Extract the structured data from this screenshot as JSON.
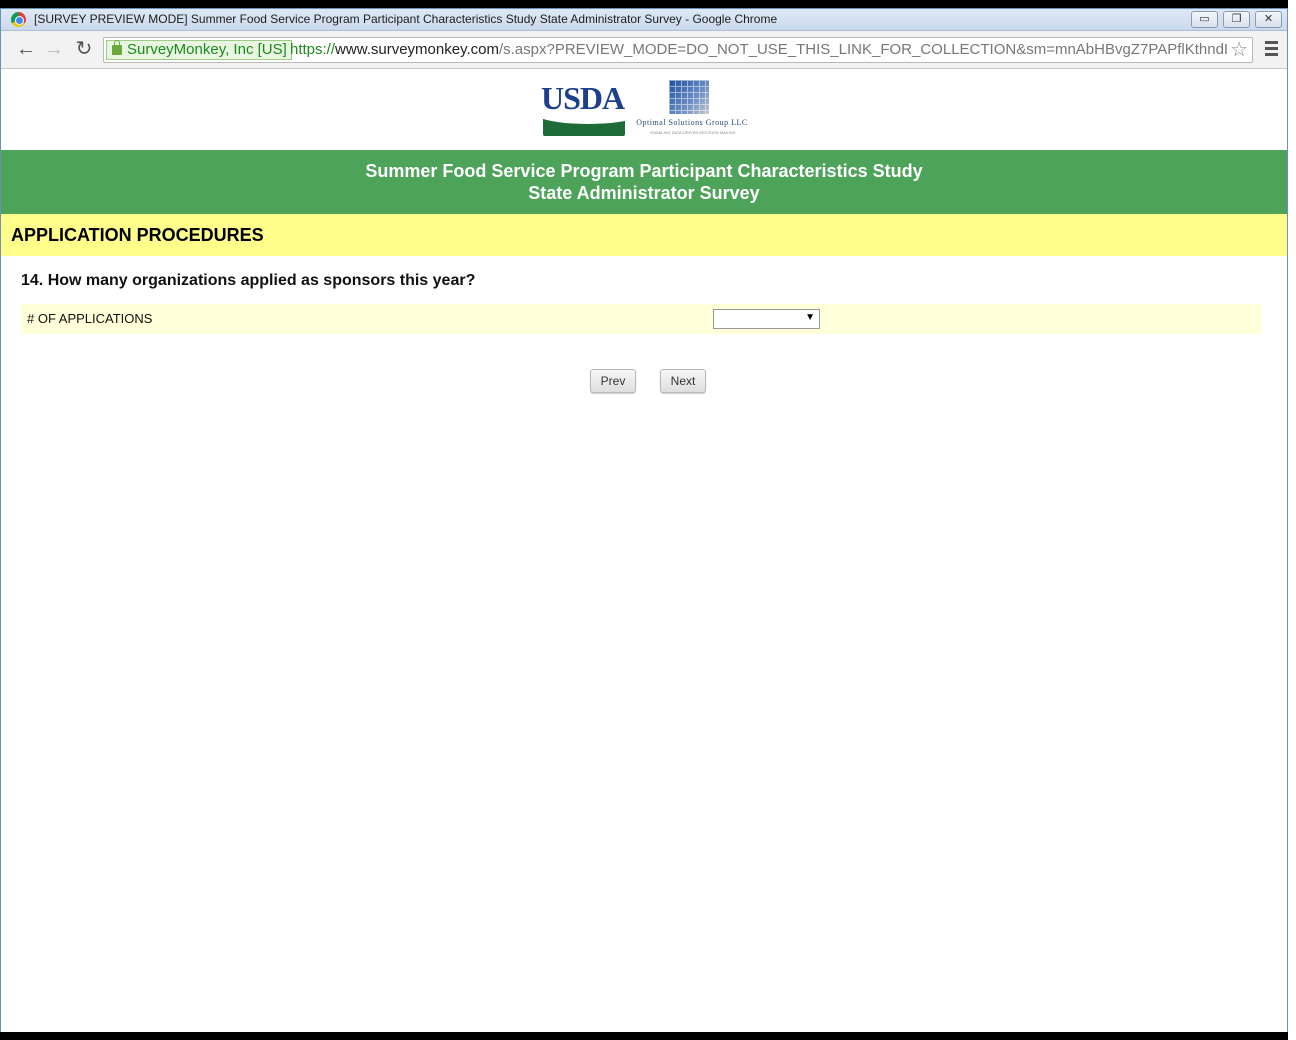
{
  "window": {
    "title": "[SURVEY PREVIEW MODE] Summer Food Service Program Participant Characteristics Study State Administrator Survey - Google Chrome",
    "minimize": "▭",
    "restore": "❐",
    "close": "✕"
  },
  "toolbar": {
    "back_icon": "←",
    "forward_icon": "→",
    "reload_icon": "↻",
    "ev_label": "SurveyMonkey, Inc [US]",
    "url_scheme": "https://",
    "url_host": "www.surveymonkey.com",
    "url_path": "/s.aspx?PREVIEW_MODE=DO_NOT_USE_THIS_LINK_FOR_COLLECTION&sm=mnAbHBvgZ7PAPflKthndI",
    "star_icon": "☆"
  },
  "logos": {
    "usda_text": "USDA",
    "osg_name": "Optimal Solutions Group LLC",
    "osg_tagline": "ENABLING DATA-DRIVEN DECISION MAKING"
  },
  "banner": {
    "line1": "Summer Food Service Program Participant Characteristics Study",
    "line2": "State Administrator Survey"
  },
  "section": {
    "title": "APPLICATION PROCEDURES"
  },
  "question": {
    "text": "14. How many organizations applied as sponsors this year?",
    "row_label": "# OF APPLICATIONS",
    "select_value": "",
    "select_arrow": "▼"
  },
  "buttons": {
    "prev": "Prev",
    "next": "Next"
  },
  "colors": {
    "banner_green": "#4ea35a",
    "section_yellow": "#fffe8a",
    "row_yellow": "#ffffd9"
  }
}
